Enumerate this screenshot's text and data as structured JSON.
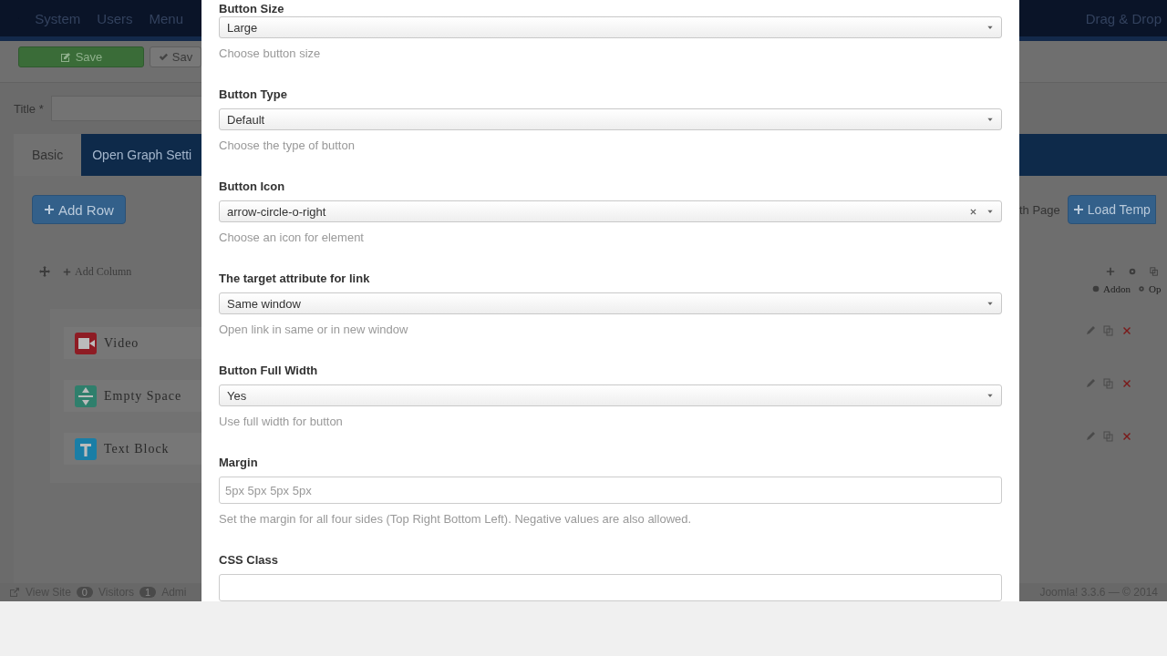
{
  "background": {
    "nav": {
      "items": [
        "System",
        "Users",
        "Menu"
      ],
      "right_title": "Drag & Drop"
    },
    "toolbar": {
      "buttons": [
        {
          "label": "Save",
          "kind": "primary"
        },
        {
          "label": "Sav",
          "kind": "default"
        }
      ]
    },
    "title_field": {
      "label": "Title *"
    },
    "tabs": [
      {
        "label": "Basic",
        "selected": true
      },
      {
        "label": "Open Graph Setti",
        "selected": false
      }
    ],
    "add_row": "Add Row",
    "add_column": "Add Column",
    "addons": [
      {
        "name": "Video",
        "kind": "video",
        "color": "#8e1c24"
      },
      {
        "name": "Empty Space",
        "kind": "space",
        "color": "#2f7f6c"
      },
      {
        "name": "Text Block",
        "kind": "text",
        "color": "#1a7ea6"
      }
    ],
    "right": {
      "partial_label": "th Page",
      "load_button": "Load Temp",
      "addon_link": "Addon",
      "options_link": "Op"
    },
    "footer": {
      "view_site": "View Site",
      "visitors_count": "0",
      "visitors": "Visitors",
      "admins_count": "1",
      "admins": "Admi",
      "version": "Joomla! 3.3.6 — © 2014"
    }
  },
  "modal": {
    "fields": [
      {
        "label": "Button Size",
        "kind": "select",
        "value": "Large",
        "clearable": false,
        "help": "Choose button size"
      },
      {
        "label": "Button Type",
        "kind": "select",
        "value": "Default",
        "clearable": false,
        "help": "Choose the type of button"
      },
      {
        "label": "Button Icon",
        "kind": "select",
        "value": "arrow-circle-o-right",
        "clearable": true,
        "help": "Choose an icon for element"
      },
      {
        "label": "The target attribute for link",
        "kind": "select",
        "value": "Same window",
        "clearable": false,
        "help": "Open link in same or in new window"
      },
      {
        "label": "Button Full Width",
        "kind": "select",
        "value": "Yes",
        "clearable": false,
        "help": "Use full width for button"
      },
      {
        "label": "Margin",
        "kind": "input",
        "placeholder": "5px 5px 5px 5px",
        "help": "Set the margin for all four sides (Top Right Bottom Left). Negative values are also allowed."
      },
      {
        "label": "CSS Class",
        "kind": "input"
      }
    ]
  }
}
